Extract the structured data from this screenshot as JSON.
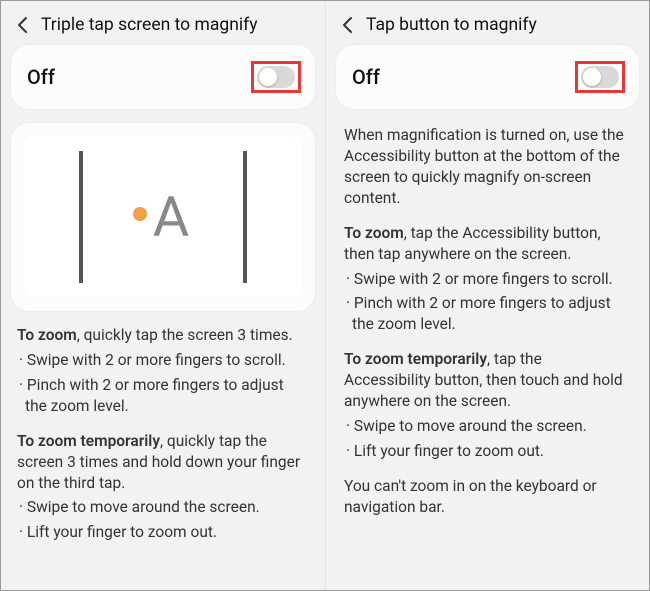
{
  "left": {
    "title": "Triple tap screen to magnify",
    "toggle_label": "Off",
    "zoom_head": "To zoom",
    "zoom_tail": ", quickly tap the screen 3 times.",
    "zoom_b1": "· Swipe with 2 or more fingers to scroll.",
    "zoom_b2": "· Pinch with 2 or more fingers to adjust the zoom level.",
    "temp_head": "To zoom temporarily",
    "temp_tail": ", quickly tap the screen 3 times and hold down your finger on the third tap.",
    "temp_b1": "· Swipe to move around the screen.",
    "temp_b2": "· Lift your finger to zoom out."
  },
  "right": {
    "title": "Tap button to magnify",
    "toggle_label": "Off",
    "intro": "When magnification is turned on, use the Accessibility button at the bottom of the screen to quickly magnify on-screen content.",
    "zoom_head": "To zoom",
    "zoom_tail": ", tap the Accessibility button, then tap anywhere on the screen.",
    "zoom_b1": "· Swipe with 2 or more fingers to scroll.",
    "zoom_b2": "· Pinch with 2 or more fingers to adjust the zoom level.",
    "temp_head": "To zoom temporarily",
    "temp_tail": ", tap the Accessibility button, then touch and hold anywhere on the screen.",
    "temp_b1": "· Swipe to move around the screen.",
    "temp_b2": "· Lift your finger to zoom out.",
    "note": "You can't zoom in on the keyboard or navigation bar."
  }
}
